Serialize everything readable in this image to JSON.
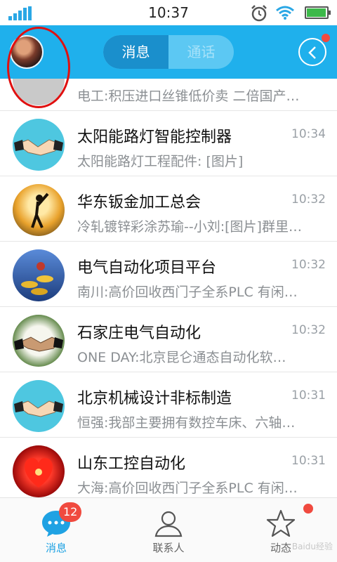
{
  "status_bar": {
    "time": "10:37",
    "icons": [
      "signal-icon",
      "alarm-icon",
      "wifi-icon",
      "battery-icon"
    ],
    "battery_level": 0.9
  },
  "header": {
    "tabs": [
      {
        "label": "消息",
        "active": true
      },
      {
        "label": "通话",
        "active": false
      }
    ],
    "accent_color": "#1fb0ec"
  },
  "conversations": [
    {
      "name": "",
      "time": "",
      "preview": "电工:积压进口丝锥低价卖 二倍国产…",
      "avatar": "machine-avatar"
    },
    {
      "name": "太阳能路灯智能控制器",
      "time": "10:34",
      "preview": "太阳能路灯工程配件: [图片]",
      "avatar": "handshake-avatar"
    },
    {
      "name": "华东钣金加工总会",
      "time": "10:32",
      "preview": "冷轧镀锌彩涂苏瑜--小刘:[图片]群里…",
      "avatar": "golfer-avatar"
    },
    {
      "name": "电气自动化项目平台",
      "time": "10:32",
      "preview": "南川:高价回收西门子全系PLC 有闲…",
      "avatar": "coins-avatar"
    },
    {
      "name": "石家庄电气自动化",
      "time": "10:32",
      "preview": "ONE DAY:北京昆仑通态自动化软…",
      "avatar": "handshake-photo-avatar"
    },
    {
      "name": "北京机械设计非标制造",
      "time": "10:31",
      "preview": "恒强:我部主要拥有数控车床、六轴…",
      "avatar": "handshake-avatar"
    },
    {
      "name": "山东工控自动化",
      "time": "10:31",
      "preview": "大海:高价回收西门子全系PLC 有闲…",
      "avatar": "heart-avatar"
    }
  ],
  "tabbar": {
    "tabs": [
      {
        "label": "消息",
        "badge": "12",
        "icon": "chat-bubble-icon",
        "active": true
      },
      {
        "label": "联系人",
        "icon": "contact-icon",
        "active": false
      },
      {
        "label": "动态",
        "icon": "star-icon",
        "active": false,
        "has_dot": true
      }
    ],
    "watermark": "Baidu经验"
  }
}
